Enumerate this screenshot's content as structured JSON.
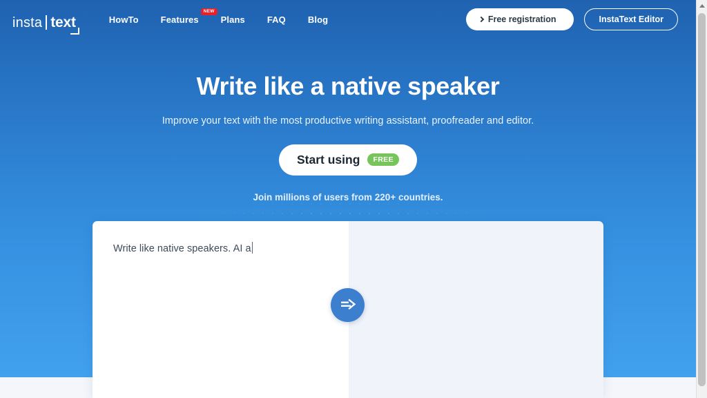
{
  "brand": {
    "logo_insta": "insta",
    "logo_text": "text"
  },
  "nav": {
    "links": [
      {
        "label": "HowTo",
        "badge": null
      },
      {
        "label": "Features",
        "badge": "NEW"
      },
      {
        "label": "Plans",
        "badge": null
      },
      {
        "label": "FAQ",
        "badge": null
      },
      {
        "label": "Blog",
        "badge": null
      }
    ],
    "free_registration_label": "Free registration",
    "editor_button_label": "InstaText Editor"
  },
  "hero": {
    "headline": "Write like a native speaker",
    "subheadline": "Improve your text with the most productive writing assistant, proofreader and editor.",
    "cta_label": "Start using",
    "cta_badge": "FREE",
    "join_line": "Join millions of users from 220+ countries."
  },
  "editor": {
    "input_text": "Write like native speakers. AI a",
    "output_text": ""
  },
  "colors": {
    "hero_gradient_top": "#1f62b0",
    "hero_gradient_bottom": "#41a1ef",
    "accent_green": "#76c55b",
    "badge_red": "#e8202a",
    "swap_button": "#3d7fcf",
    "page_background": "#f4f6fb"
  },
  "icons": {
    "chevron_right": "chevron-right-icon",
    "swap": "rephrase-arrow-icon",
    "scroll_up": "scroll-up-arrow-icon"
  }
}
